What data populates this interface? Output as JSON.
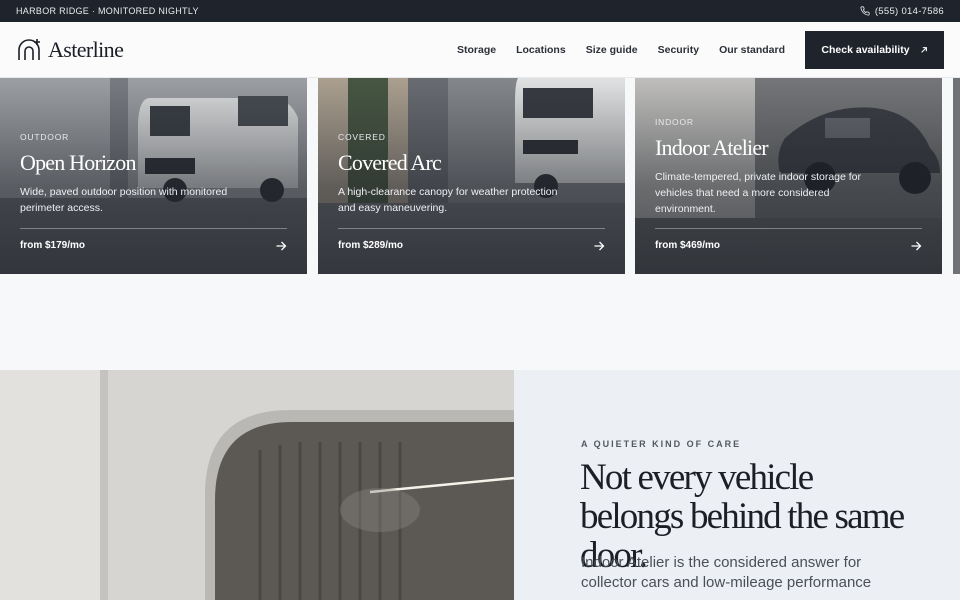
{
  "topbar": {
    "tagline": "HARBOR RIDGE · MONITORED NIGHTLY",
    "phone": "(555) 014-7586"
  },
  "brand": {
    "name": "Asterline"
  },
  "nav": {
    "items": [
      "Storage",
      "Locations",
      "Size guide",
      "Security",
      "Our standard"
    ],
    "cta_label": "Check availability"
  },
  "cards": [
    {
      "eyebrow": "OUTDOOR",
      "title": "Open Horizon",
      "description": "Wide, paved outdoor position with monitored perimeter access.",
      "price": "from $179/mo"
    },
    {
      "eyebrow": "COVERED",
      "title": "Covered Arc",
      "description": "A high-clearance canopy for weather protection and easy maneuvering.",
      "price": "from $289/mo"
    },
    {
      "eyebrow": "INDOOR",
      "title": "Indoor Atelier",
      "description": "Climate-tempered, private indoor storage for vehicles that need a more considered environment.",
      "price": "from $469/mo"
    }
  ],
  "feature": {
    "eyebrow": "A QUIETER KIND OF CARE",
    "heading": "Not every vehicle belongs behind the same door.",
    "body": "Indoor Atelier is the considered answer for collector cars and low-mileage performance"
  },
  "colors": {
    "dark": "#1f232b",
    "page": "#f7f8fa",
    "feature_panel": "#eceff3"
  }
}
